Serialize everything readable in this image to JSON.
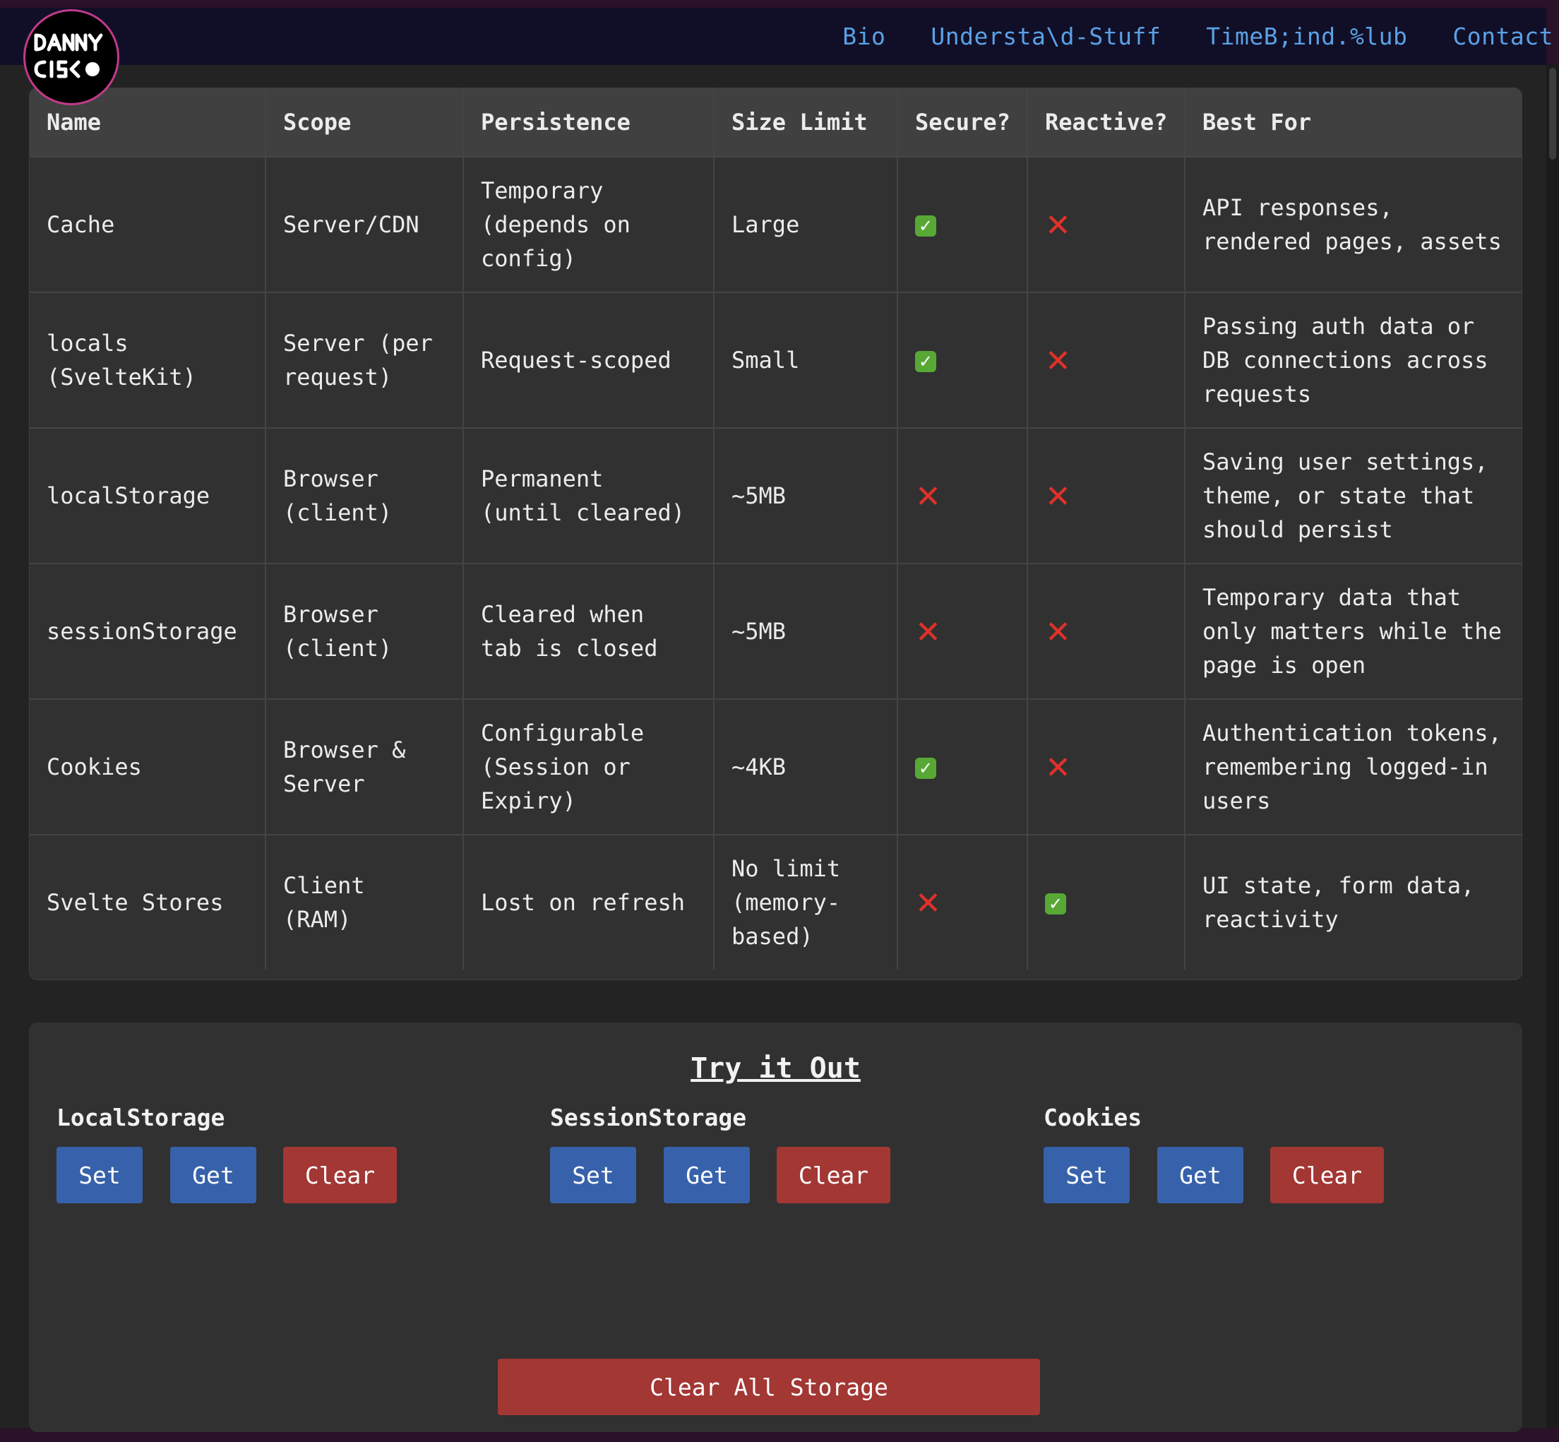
{
  "nav": {
    "links": [
      "Bio",
      "Understa\\d-Stuff",
      "TimeB;ind.%lub",
      "Contact"
    ]
  },
  "logo": {
    "lines": [
      "DANNY",
      "CISCO"
    ]
  },
  "table": {
    "headers": [
      "Name",
      "Scope",
      "Persistence",
      "Size Limit",
      "Secure?",
      "Reactive?",
      "Best For"
    ],
    "rows": [
      {
        "name": "Cache",
        "scope": "Server/CDN",
        "persistence": "Temporary (depends on config)",
        "size": "Large",
        "secure": true,
        "reactive": false,
        "best_for": "API responses, rendered pages, assets"
      },
      {
        "name": "locals (SvelteKit)",
        "scope": "Server (per request)",
        "persistence": "Request-scoped",
        "size": "Small",
        "secure": true,
        "reactive": false,
        "best_for": "Passing auth data or DB connections across requests"
      },
      {
        "name": "localStorage",
        "scope": "Browser (client)",
        "persistence": "Permanent (until cleared)",
        "size": "~5MB",
        "secure": false,
        "reactive": false,
        "best_for": "Saving user settings, theme, or state that should persist"
      },
      {
        "name": "sessionStorage",
        "scope": "Browser (client)",
        "persistence": "Cleared when tab is closed",
        "size": "~5MB",
        "secure": false,
        "reactive": false,
        "best_for": "Temporary data that only matters while the page is open"
      },
      {
        "name": "Cookies",
        "scope": "Browser & Server",
        "persistence": "Configurable (Session or Expiry)",
        "size": "~4KB",
        "secure": true,
        "reactive": false,
        "best_for": "Authentication tokens, remembering logged-in users"
      },
      {
        "name": "Svelte Stores",
        "scope": "Client (RAM)",
        "persistence": "Lost on refresh",
        "size": "No limit (memory-based)",
        "secure": false,
        "reactive": true,
        "best_for": "UI state, form data, reactivity"
      }
    ],
    "icons": {
      "yes": "check-icon",
      "no": "cross-icon"
    }
  },
  "try": {
    "title": "Try it Out",
    "groups": [
      {
        "title": "LocalStorage",
        "set": "Set",
        "get": "Get",
        "clear": "Clear"
      },
      {
        "title": "SessionStorage",
        "set": "Set",
        "get": "Get",
        "clear": "Clear"
      },
      {
        "title": "Cookies",
        "set": "Set",
        "get": "Get",
        "clear": "Clear"
      }
    ],
    "clear_all": "Clear All Storage"
  },
  "colors": {
    "accent_blue": "#3762ab",
    "accent_red": "#a23734",
    "nav_link": "#5aa1e6",
    "check_green": "#58a836",
    "cross_red": "#e0312a"
  }
}
